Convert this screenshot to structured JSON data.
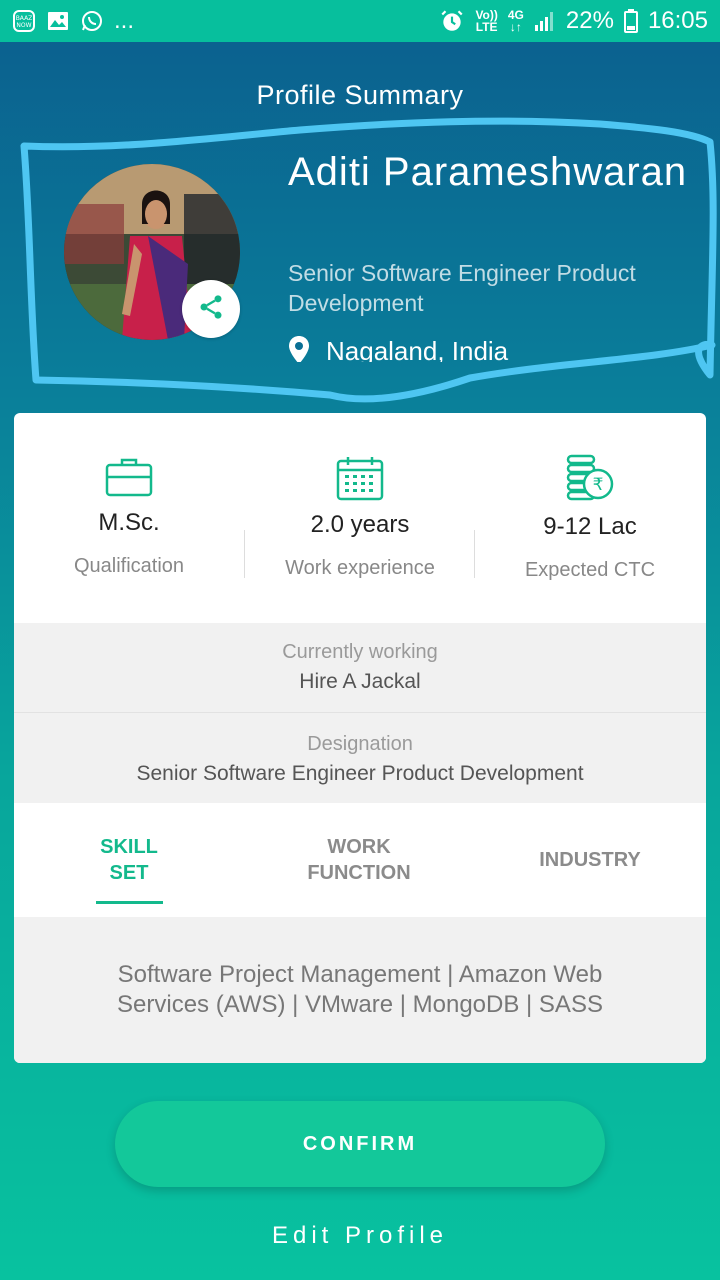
{
  "status_bar": {
    "left_icons": [
      "baaz-now-icon",
      "gallery-icon",
      "whatsapp-icon"
    ],
    "more_dots": "...",
    "volte_top": "Vo))",
    "volte_bottom": "LTE",
    "network_top": "4G",
    "network_bottom": "↓↑",
    "battery": "22%",
    "time": "16:05"
  },
  "header": {
    "title": "Profile Summary",
    "name": "Aditi Parameshwaran",
    "role": "Senior Software Engineer Product\nDevelopment",
    "location": "Nagaland, India"
  },
  "stats": [
    {
      "icon": "briefcase-icon",
      "value": "M.Sc.",
      "label": "Qualification"
    },
    {
      "icon": "calendar-icon",
      "value": "2.0 years",
      "label": "Work experience"
    },
    {
      "icon": "rupee-coins-icon",
      "value": "9-12 Lac",
      "label": "Expected CTC"
    }
  ],
  "current": {
    "label": "Currently working",
    "value": "Hire A Jackal"
  },
  "designation": {
    "label": "Designation",
    "value": "Senior Software Engineer Product Development"
  },
  "tabs": [
    {
      "label": "SKILL\nSET",
      "active": true
    },
    {
      "label": "WORK\nFUNCTION",
      "active": false
    },
    {
      "label": "INDUSTRY",
      "active": false
    }
  ],
  "skills_text": "Software Project Management | Amazon Web Services (AWS) | VMware | MongoDB | SASS",
  "actions": {
    "confirm": "CONFIRM",
    "edit": "Edit Profile"
  },
  "colors": {
    "accent": "#13b98c",
    "status_bar": "#07bf9d",
    "annotation": "#4ec6f2"
  }
}
